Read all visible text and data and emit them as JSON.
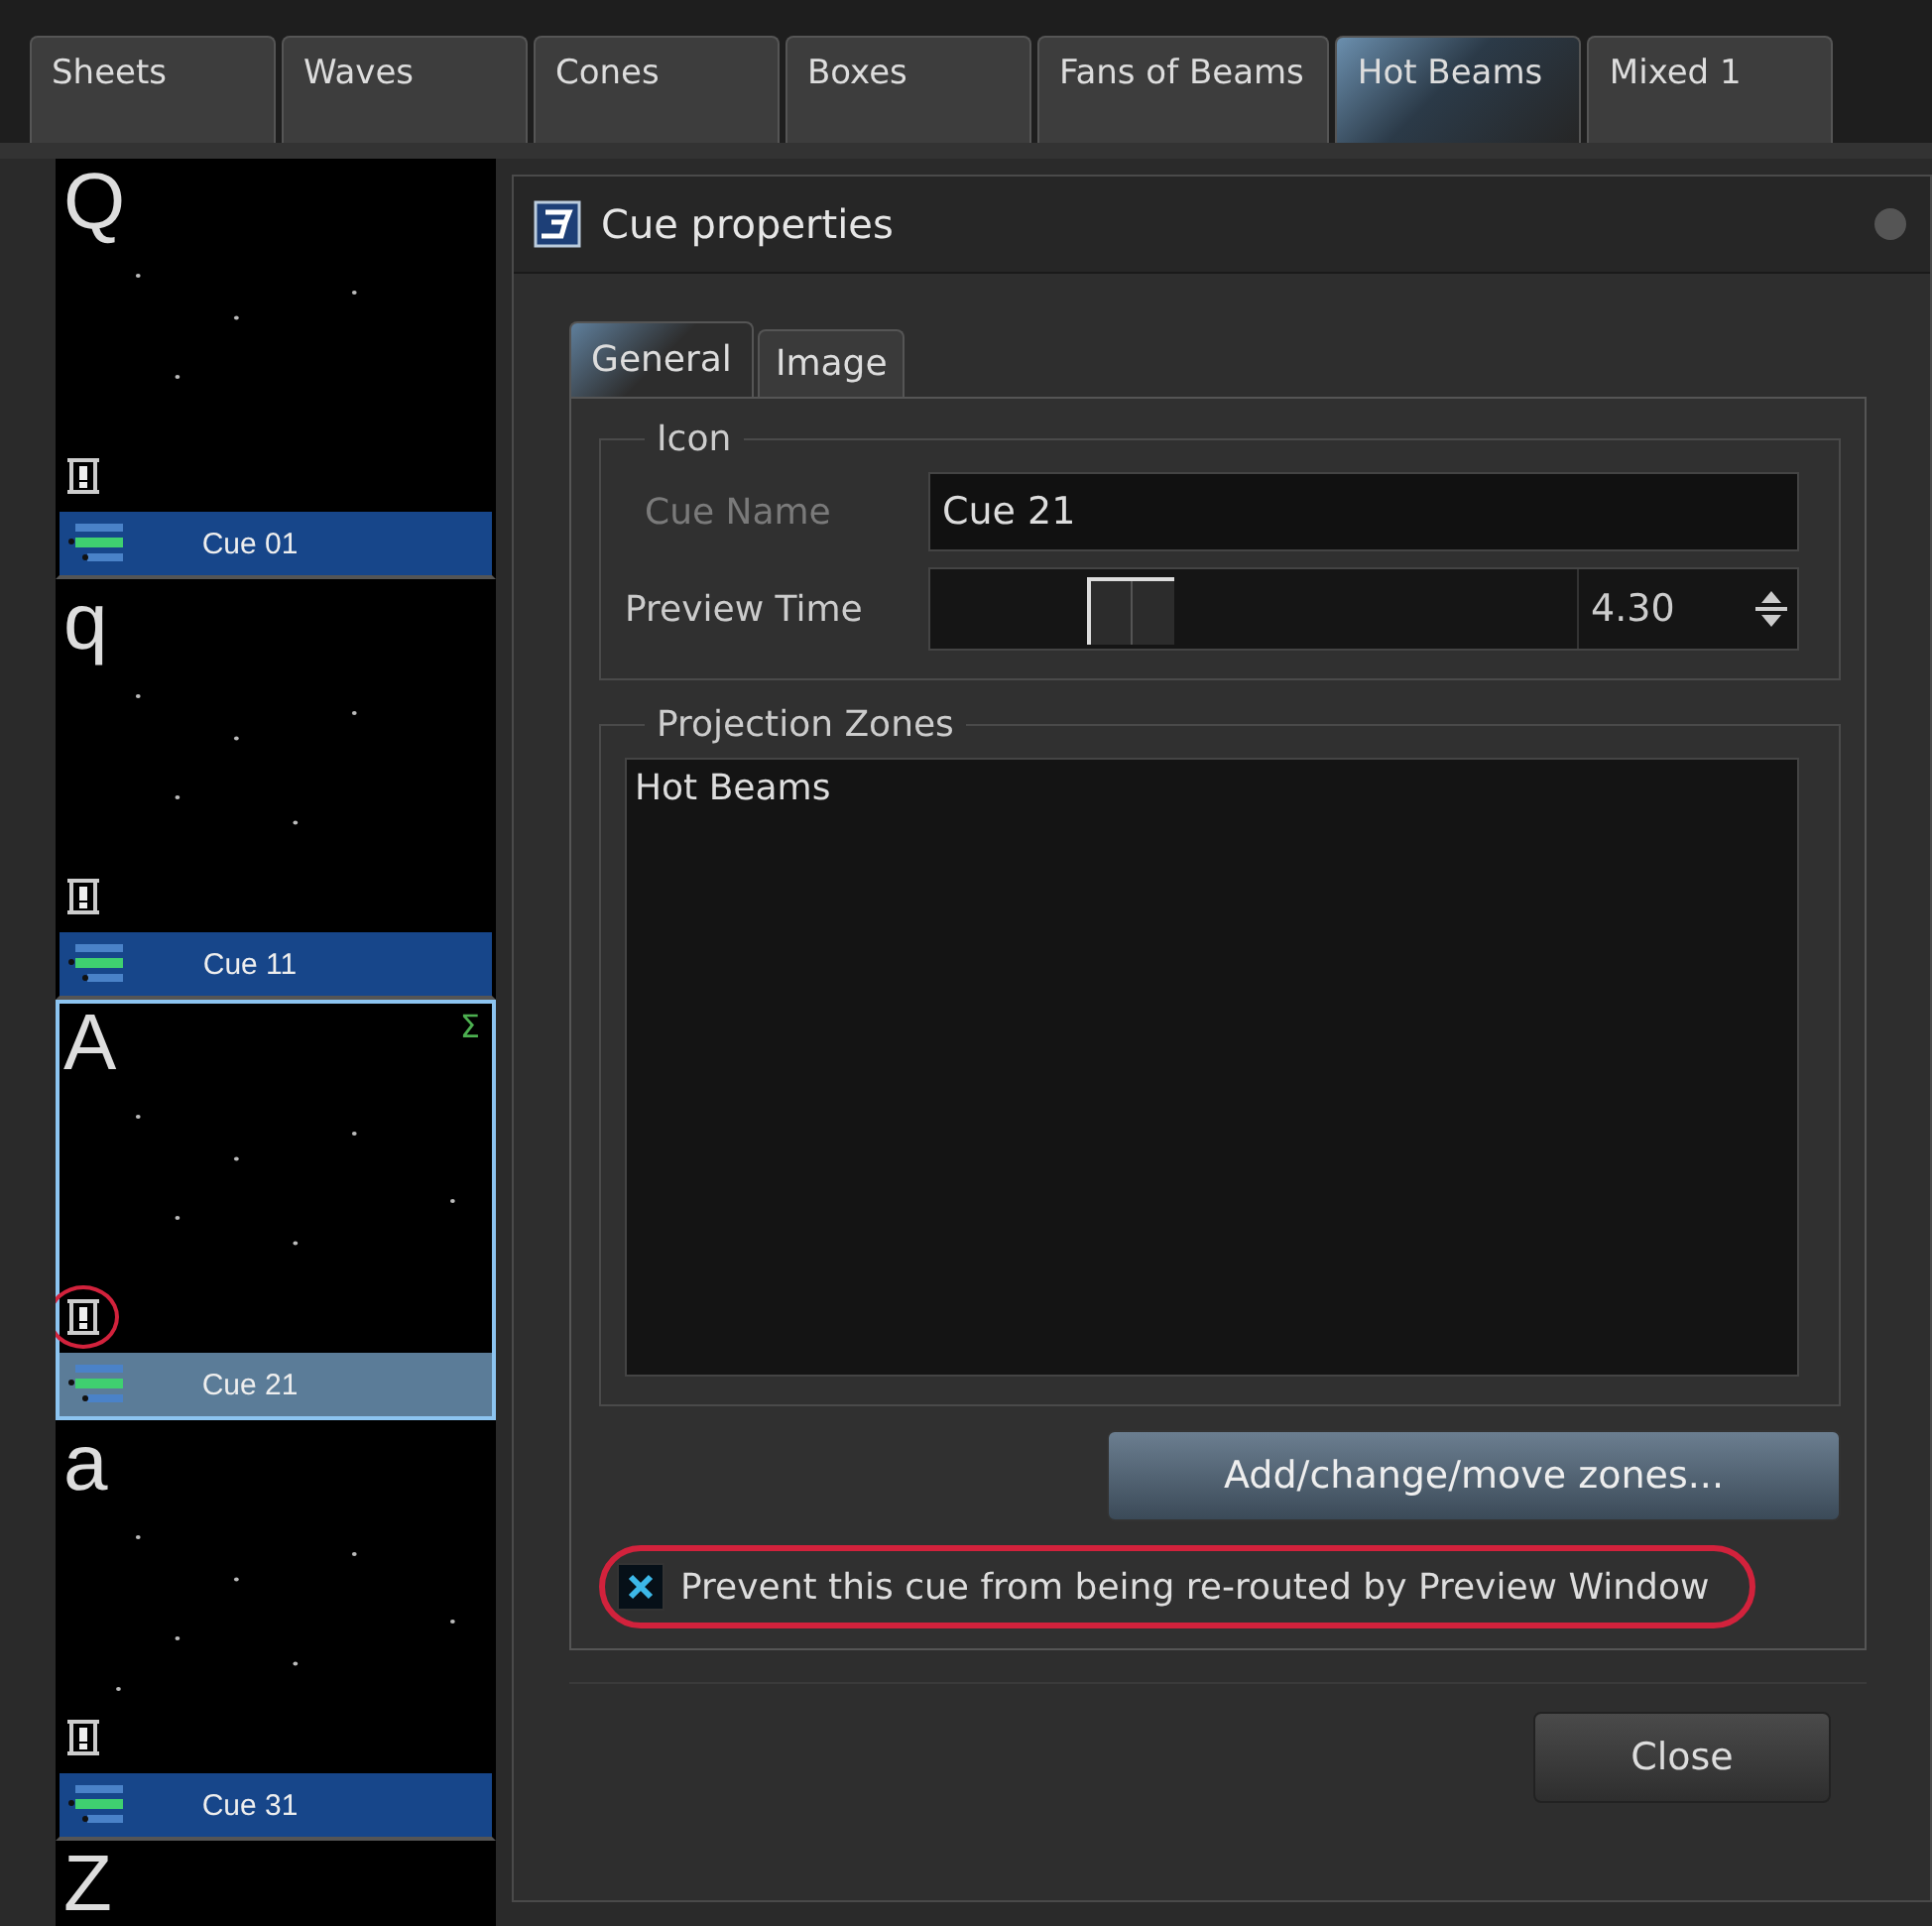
{
  "tabs": [
    {
      "label": "Sheets",
      "selected": false
    },
    {
      "label": "Waves",
      "selected": false
    },
    {
      "label": "Cones",
      "selected": false
    },
    {
      "label": "Boxes",
      "selected": false
    },
    {
      "label": "Fans of Beams",
      "selected": false
    },
    {
      "label": "Hot Beams",
      "selected": true
    },
    {
      "label": "Mixed 1",
      "selected": false
    }
  ],
  "cues": [
    {
      "letter": "Q",
      "label": "Cue 01",
      "selected": false
    },
    {
      "letter": "q",
      "label": "Cue 11",
      "selected": false
    },
    {
      "letter": "A",
      "label": "Cue 21",
      "selected": true,
      "badge": "Σ",
      "circled": true
    },
    {
      "letter": "a",
      "label": "Cue 31",
      "selected": false
    },
    {
      "letter": "Z",
      "selected": false
    }
  ],
  "dialog": {
    "title": "Cue properties",
    "tabs": [
      {
        "label": "General",
        "selected": true
      },
      {
        "label": "Image",
        "selected": false
      }
    ],
    "icon_group": {
      "legend": "Icon",
      "cue_name": {
        "label": "Cue Name",
        "disabled": true,
        "value": "Cue 21"
      },
      "preview_time": {
        "label": "Preview Time",
        "level": 0.31,
        "value": "4.30"
      }
    },
    "zones_group": {
      "legend": "Projection Zones",
      "items": [
        "Hot Beams"
      ]
    },
    "zones_button": "Add/change/move zones...",
    "prevent_checkbox": {
      "label": "Prevent this cue from being re-routed by Preview Window",
      "checked": true,
      "circled": true
    },
    "close_button": "Close"
  }
}
